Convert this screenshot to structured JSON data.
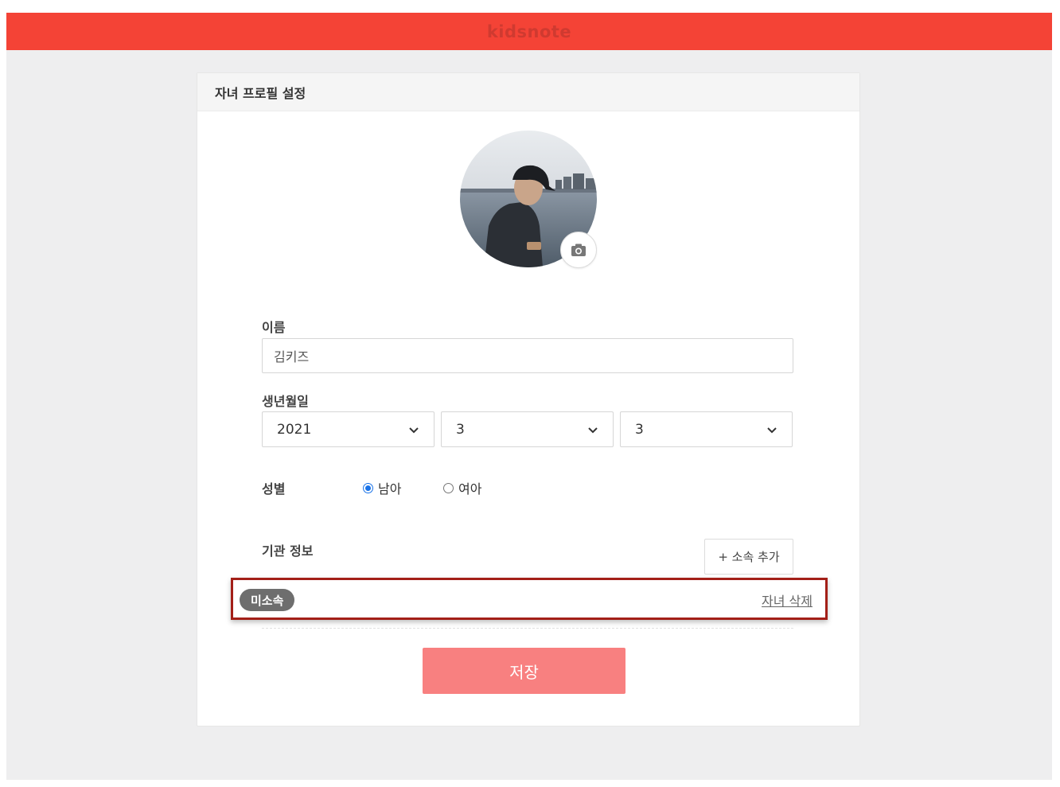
{
  "app": {
    "brand": "kidsnote"
  },
  "card": {
    "title": "자녀 프로필 설정"
  },
  "avatar": {
    "camera_icon": "camera-icon"
  },
  "form": {
    "name_label": "이름",
    "name_value": "김키즈",
    "birth_label": "생년월일",
    "birth_year": "2021",
    "birth_month": "3",
    "birth_day": "3",
    "gender_label": "성별",
    "gender_options": [
      "남아",
      "여아"
    ],
    "gender_selected": "남아",
    "org_label": "기관 정보",
    "add_org_label": "+ 소속 추가",
    "org_badge": "미소속",
    "delete_child_label": "자녀 삭제",
    "save_label": "저장"
  },
  "colors": {
    "topbar": "#f44336",
    "save_button": "#f88080",
    "highlight_border": "#a31f18",
    "radio_selected": "#1a73e8"
  }
}
